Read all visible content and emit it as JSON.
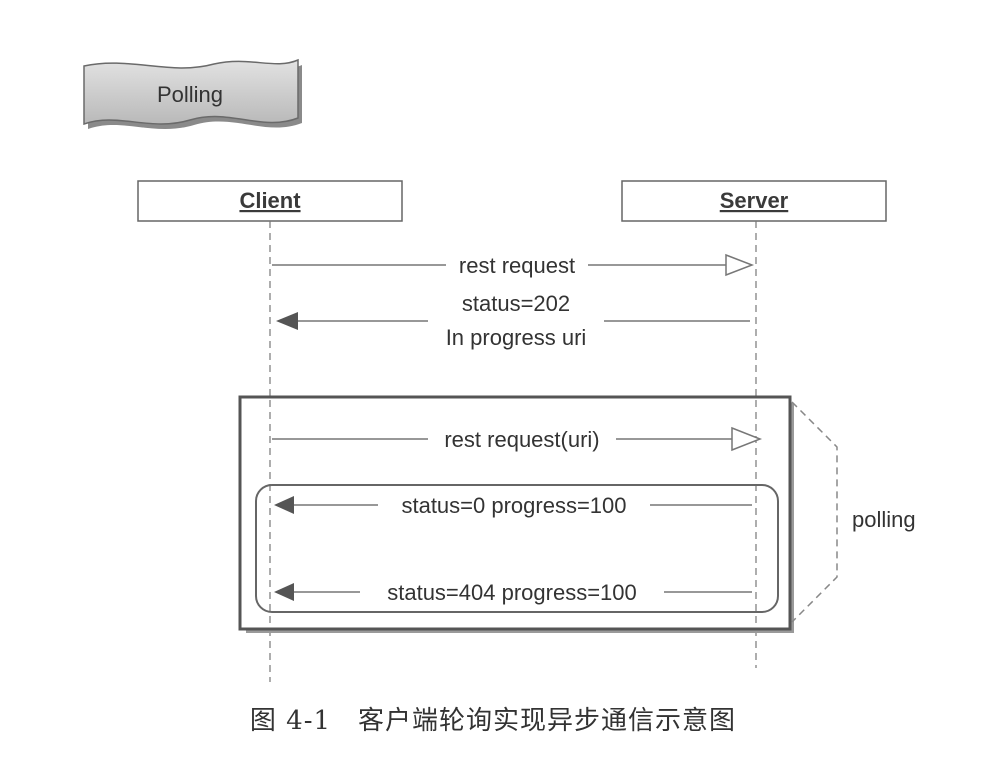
{
  "title_tag": "Polling",
  "participants": {
    "client": "Client",
    "server": "Server"
  },
  "messages": {
    "rest_request": "rest request",
    "status_202_line1": "status=202",
    "status_202_line2": "In progress uri",
    "rest_request_uri": "rest request(uri)",
    "status_0": "status=0 progress=100",
    "status_404": "status=404 progress=100"
  },
  "loop_label": "polling",
  "caption": "图 4-1　客户端轮询实现异步通信示意图",
  "colors": {
    "line": "#777777",
    "box_border": "#555555",
    "tag_fill": "#c9c9c9"
  }
}
